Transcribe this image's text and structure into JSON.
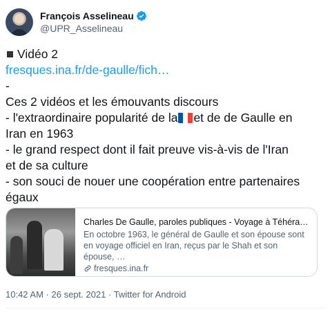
{
  "author": {
    "name": "François Asselineau",
    "handle": "@UPR_Asselineau",
    "verified_icon": "verified-badge-icon",
    "verified_color": "#1d9bf0"
  },
  "tweet": {
    "line1": "Vidéo 2",
    "link_text": "fresques.ina.fr/de-gaulle/fich…",
    "dash_line": "-",
    "line_intro": "Ces 2 vidéos et les émouvants discours",
    "line_pop_a": "- l'extraordinaire popularité de la",
    "line_pop_b": "et de de Gaulle en",
    "line_pop_c": "Iran en 1963",
    "line_respect_a": "- le grand respect dont il fait preuve vis-à-vis de l'Iran",
    "line_respect_b": "et de sa culture",
    "line_souci_a": "- son souci de nouer une coopération entre partenaires",
    "line_souci_b": "égaux"
  },
  "card": {
    "title": "Charles De Gaulle, paroles publiques - Voyage à Téhéran (d…",
    "description": "En octobre 1963, le général de Gaulle et son épouse sont en voyage officiel en Iran, reçus par le Shah et son épouse, …",
    "domain": "fresques.ina.fr"
  },
  "meta": {
    "time": "10:42 AM",
    "separator": "·",
    "date": "26 sept. 2021",
    "source": "Twitter for Android"
  },
  "colors": {
    "link": "#1d9bf0",
    "text": "#0f1419",
    "secondary": "#536471",
    "border": "#cfd9de"
  }
}
